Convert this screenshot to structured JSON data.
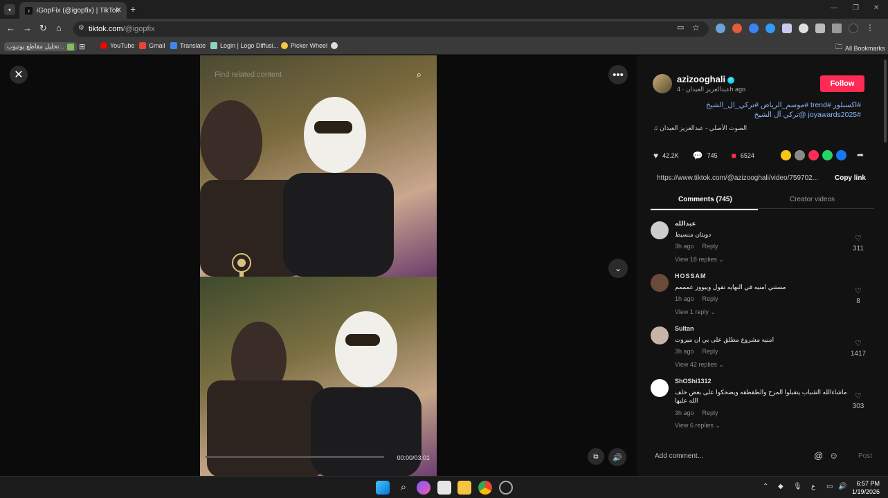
{
  "browser": {
    "tab_title": "iGopFix (@igopfix) | TikTok",
    "url_host": "tiktok.com",
    "url_path": "/@igopfix"
  },
  "bookmarks": [
    {
      "label": "تحليل مقاطع يوتيوب...",
      "color": "#7fbf5f"
    },
    {
      "label": "YouTube",
      "color": "#ff0000"
    },
    {
      "label": "Gmail",
      "color": "#ea4335"
    },
    {
      "label": "Translate",
      "color": "#4285f4"
    },
    {
      "label": "Login | Logo Diffusi...",
      "color": "#8fd1c3"
    },
    {
      "label": "Picker Wheel",
      "color": "#f6c945"
    },
    {
      "label": "",
      "color": "#dddddd"
    }
  ],
  "all_bookmarks": "All Bookmarks",
  "video": {
    "find_related": "Find related content",
    "time": "00:00/03:01",
    "progress": 0.0
  },
  "post": {
    "username": "azizooghali",
    "display_name": "عبدالعزيز العيدان",
    "age": "4h ago",
    "follow_label": "Follow",
    "caption": "#اكسبلور #trend #موسم_الرياض #تركي_ال_الشيخ #joyawards2025 @تركي آل الشيخ",
    "music": "الصوت الأصلي - عبدالعزيز العيدان",
    "likes": "42.2K",
    "comments": "745",
    "saves": "6524",
    "link": "https://www.tiktok.com/@azizooghali/video/759702...",
    "copy_link": "Copy link"
  },
  "tabs": {
    "comments": "Comments (745)",
    "creator_videos": "Creator videos"
  },
  "comments": [
    {
      "user": "عبدالله",
      "text": "دويتان منسيط",
      "time": "3h ago",
      "reply": "Reply",
      "view": "View 18 replies",
      "likes": "311",
      "avatar": "#cccccc"
    },
    {
      "user": "HOSSAM",
      "text": "مستني امنيه في النهايه تقول وييووز عمممم",
      "time": "1h ago",
      "reply": "Reply",
      "view": "View 1 reply",
      "likes": "8",
      "avatar": "#6b4a3a"
    },
    {
      "user": "Sultan",
      "text": "امنيه مشروع مطلق على بي ان ميروت",
      "time": "3h ago",
      "reply": "Reply",
      "view": "View 42 replies",
      "likes": "1417",
      "avatar": "#c9b5a8"
    },
    {
      "user": "ShOShi1312",
      "text": "ماشاءالله الشباب يتقبلوا المزح والطقطقه ويضحكوا على بعض خلف الله عليها",
      "time": "3h ago",
      "reply": "Reply",
      "view": "View 6 replies",
      "likes": "303",
      "avatar": "#ffffff"
    }
  ],
  "comment_input": {
    "placeholder": "Add comment...",
    "post": "Post"
  },
  "taskbar": {
    "time": "6:57 PM",
    "date": "1/19/2026",
    "lang": "ع"
  }
}
